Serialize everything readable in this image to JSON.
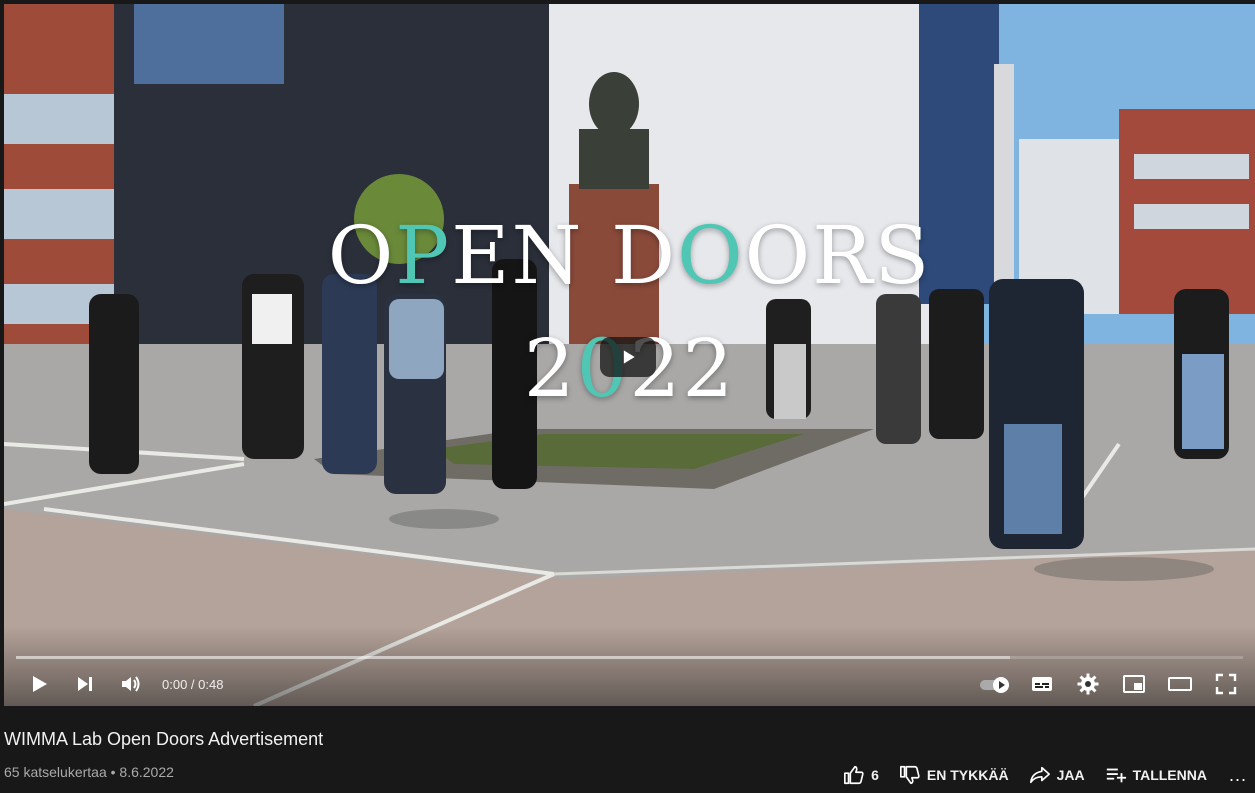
{
  "player": {
    "overlay_title_part1": "O",
    "overlay_title_part2": "P",
    "overlay_title_part3": "EN D",
    "overlay_title_part4": "O",
    "overlay_title_part5": "ORS",
    "overlay_year_part1": "2",
    "overlay_year_part2": "0",
    "overlay_year_part3": "22",
    "time_display": "0:00 / 0:48",
    "buffered_fraction": 0.81,
    "accent_color": "#4fc7b4"
  },
  "video": {
    "title": "WIMMA Lab Open Doors Advertisement",
    "views": "65 katselukertaa",
    "separator": "•",
    "date": "8.6.2022"
  },
  "actions": {
    "like_count": "6",
    "dislike_label": "EN TYKKÄÄ",
    "share_label": "JAA",
    "save_label": "TALLENNA",
    "more_label": "..."
  }
}
